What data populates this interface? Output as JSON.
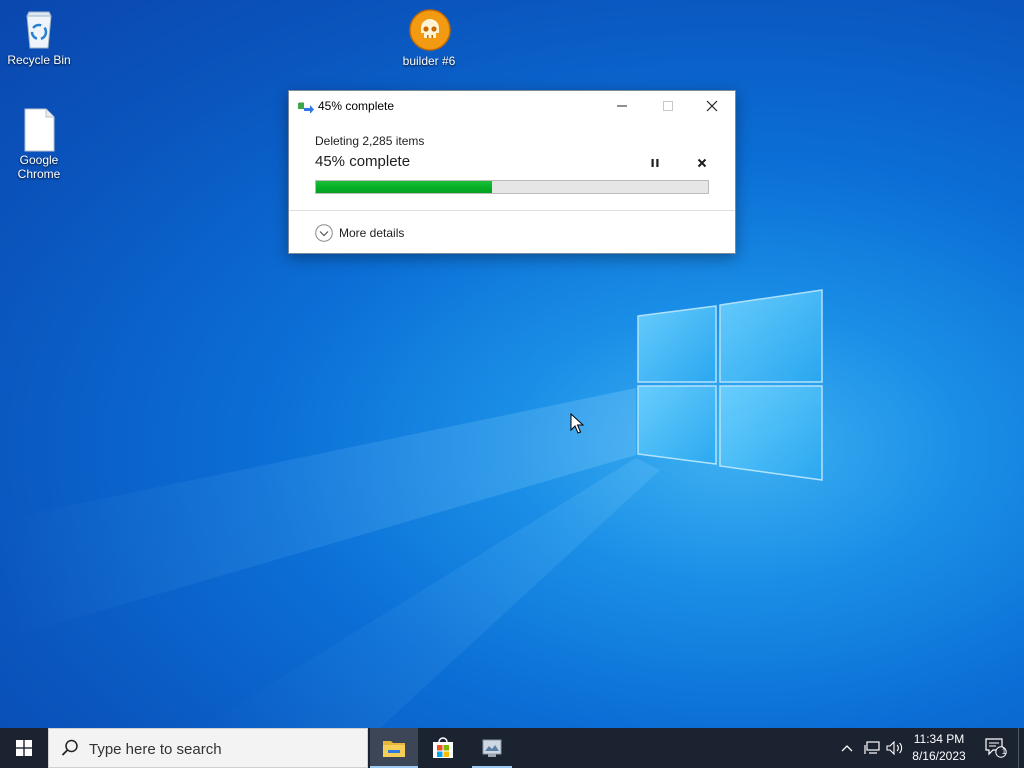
{
  "desktop": {
    "icons": [
      {
        "label": "Recycle Bin",
        "icon": "recycle-bin-icon"
      },
      {
        "label": "builder #6",
        "icon": "skull-icon"
      },
      {
        "label": "Google Chrome",
        "icon": "blank-file-icon"
      }
    ]
  },
  "dialog": {
    "title": "45% complete",
    "operation": "Deleting 2,285 items",
    "status": "45% complete",
    "progress_percent": 45,
    "more_details_label": "More details",
    "progress_color": "#06b025"
  },
  "taskbar": {
    "search_placeholder": "Type here to search",
    "time": "11:34 PM",
    "date": "8/16/2023",
    "notification_count": "1",
    "apps": [
      "file-explorer-icon",
      "microsoft-store-icon",
      "app-icon"
    ],
    "tray_icons": [
      "chevron-up-icon",
      "network-icon",
      "volume-icon"
    ]
  },
  "colors": {
    "taskbar_bg": "#1b2230",
    "accent": "#0a6fd6"
  }
}
